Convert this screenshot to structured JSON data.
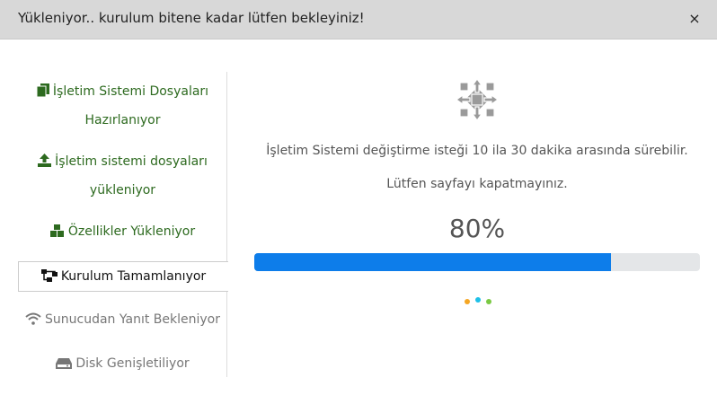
{
  "header": {
    "title": "Yükleniyor.. kurulum bitene kadar lütfen bekleyiniz!",
    "close_label": "×"
  },
  "steps": [
    {
      "line1": "İşletim Sistemi Dosyaları",
      "line2": "Hazırlanıyor",
      "icon": "copy-icon",
      "state": "done"
    },
    {
      "line1": "İşletim sistemi dosyaları",
      "line2": "yükleniyor",
      "icon": "upload-icon",
      "state": "done"
    },
    {
      "line1": "Özellikler Yükleniyor",
      "icon": "cubes-icon",
      "state": "done"
    },
    {
      "line1": "Kurulum Tamamlanıyor",
      "icon": "sitemap-icon",
      "state": "active"
    },
    {
      "line1": "Sunucudan Yanıt Bekleniyor",
      "icon": "wifi-icon",
      "state": "pending"
    },
    {
      "line1": "Disk Genişletiliyor",
      "icon": "hdd-icon",
      "state": "pending"
    }
  ],
  "main": {
    "logo_icon": "os-logo-icon",
    "message": "İşletim Sistemi değiştirme isteği 10 ila 30 dakika arasında sürebilir.",
    "warning": "Lütfen sayfayı kapatmayınız.",
    "percent_label": "80%",
    "progress": 0.8
  },
  "colors": {
    "done": "#2d6a1f",
    "pending": "#777777",
    "progress_fill": "#0d7dea",
    "progress_track": "#e4e6e8",
    "header_bg": "#d8d8d8",
    "dot_colors": [
      "#f5a623",
      "#1ec0e8",
      "#7ac943"
    ]
  }
}
